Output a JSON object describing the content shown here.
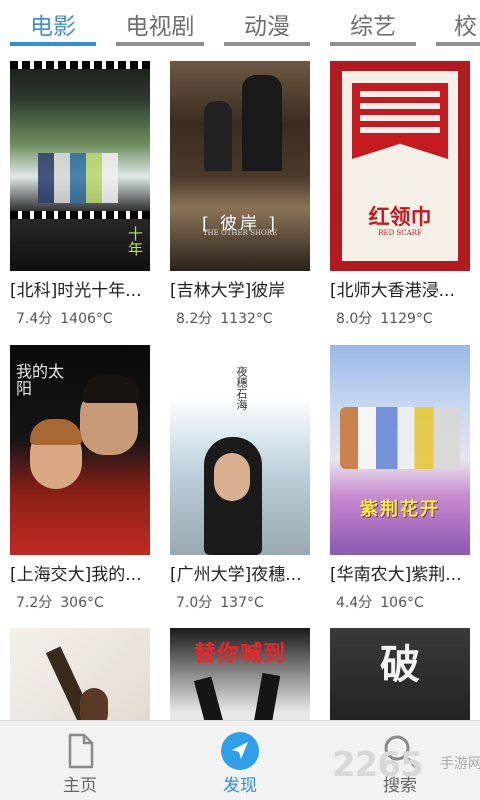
{
  "tabs": [
    {
      "label": "电影",
      "active": true
    },
    {
      "label": "电视剧",
      "active": false
    },
    {
      "label": "动漫",
      "active": false
    },
    {
      "label": "综艺",
      "active": false
    },
    {
      "label": "校",
      "active": false
    }
  ],
  "movies": [
    {
      "title": "[北科]时光十年...",
      "rating": "7.4分",
      "temp": "1406°C",
      "poster_text": "十年"
    },
    {
      "title": "[吉林大学]彼岸",
      "rating": "8.2分",
      "temp": "1132°C",
      "poster_text": "[ 彼岸 ]",
      "poster_sub": "THE OTHER SHORE"
    },
    {
      "title": "[北师大香港浸...",
      "rating": "8.0分",
      "temp": "1129°C",
      "poster_text": "红领巾",
      "poster_sub": "RED SCARF"
    },
    {
      "title": "[上海交大]我的...",
      "rating": "7.2分",
      "temp": "306°C",
      "poster_text": "我的太阳"
    },
    {
      "title": "[广州大学]夜穗...",
      "rating": "7.0分",
      "temp": "137°C",
      "poster_text": "夜穗石海"
    },
    {
      "title": "[华南农大]紫荆...",
      "rating": "4.4分",
      "temp": "106°C",
      "poster_text": "紫荆花开"
    },
    {
      "title": "",
      "rating": "",
      "temp": "",
      "poster_text": ""
    },
    {
      "title": "",
      "rating": "",
      "temp": "",
      "poster_text": "替你喊到"
    },
    {
      "title": "",
      "rating": "",
      "temp": "",
      "poster_text": "破"
    }
  ],
  "nav": [
    {
      "label": "主页",
      "icon": "document-icon",
      "active": false
    },
    {
      "label": "发现",
      "icon": "compass-icon",
      "active": true
    },
    {
      "label": "搜索",
      "icon": "search-icon",
      "active": false
    }
  ],
  "watermark": {
    "number": "2265",
    "text": "手游网"
  },
  "colors": {
    "accent": "#2f8fd8",
    "tab_inactive": "#8f8f8f",
    "nav_bg": "#f2f2f2"
  }
}
